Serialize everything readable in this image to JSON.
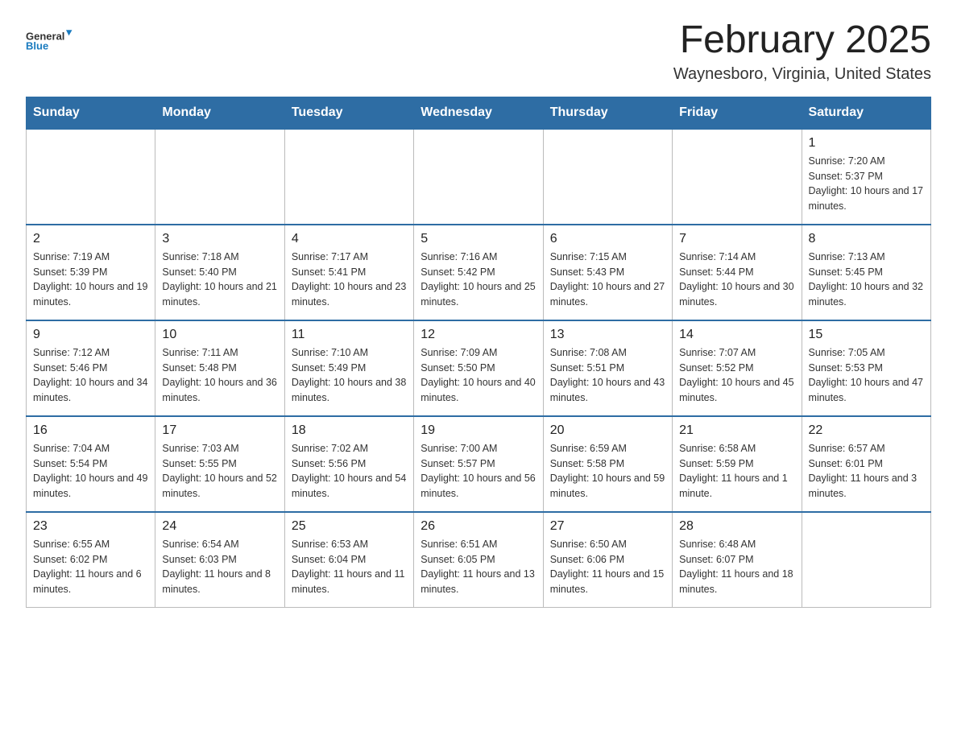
{
  "header": {
    "month_title": "February 2025",
    "location": "Waynesboro, Virginia, United States"
  },
  "days_of_week": [
    "Sunday",
    "Monday",
    "Tuesday",
    "Wednesday",
    "Thursday",
    "Friday",
    "Saturday"
  ],
  "weeks": [
    [
      {
        "day": "",
        "info": ""
      },
      {
        "day": "",
        "info": ""
      },
      {
        "day": "",
        "info": ""
      },
      {
        "day": "",
        "info": ""
      },
      {
        "day": "",
        "info": ""
      },
      {
        "day": "",
        "info": ""
      },
      {
        "day": "1",
        "info": "Sunrise: 7:20 AM\nSunset: 5:37 PM\nDaylight: 10 hours and 17 minutes."
      }
    ],
    [
      {
        "day": "2",
        "info": "Sunrise: 7:19 AM\nSunset: 5:39 PM\nDaylight: 10 hours and 19 minutes."
      },
      {
        "day": "3",
        "info": "Sunrise: 7:18 AM\nSunset: 5:40 PM\nDaylight: 10 hours and 21 minutes."
      },
      {
        "day": "4",
        "info": "Sunrise: 7:17 AM\nSunset: 5:41 PM\nDaylight: 10 hours and 23 minutes."
      },
      {
        "day": "5",
        "info": "Sunrise: 7:16 AM\nSunset: 5:42 PM\nDaylight: 10 hours and 25 minutes."
      },
      {
        "day": "6",
        "info": "Sunrise: 7:15 AM\nSunset: 5:43 PM\nDaylight: 10 hours and 27 minutes."
      },
      {
        "day": "7",
        "info": "Sunrise: 7:14 AM\nSunset: 5:44 PM\nDaylight: 10 hours and 30 minutes."
      },
      {
        "day": "8",
        "info": "Sunrise: 7:13 AM\nSunset: 5:45 PM\nDaylight: 10 hours and 32 minutes."
      }
    ],
    [
      {
        "day": "9",
        "info": "Sunrise: 7:12 AM\nSunset: 5:46 PM\nDaylight: 10 hours and 34 minutes."
      },
      {
        "day": "10",
        "info": "Sunrise: 7:11 AM\nSunset: 5:48 PM\nDaylight: 10 hours and 36 minutes."
      },
      {
        "day": "11",
        "info": "Sunrise: 7:10 AM\nSunset: 5:49 PM\nDaylight: 10 hours and 38 minutes."
      },
      {
        "day": "12",
        "info": "Sunrise: 7:09 AM\nSunset: 5:50 PM\nDaylight: 10 hours and 40 minutes."
      },
      {
        "day": "13",
        "info": "Sunrise: 7:08 AM\nSunset: 5:51 PM\nDaylight: 10 hours and 43 minutes."
      },
      {
        "day": "14",
        "info": "Sunrise: 7:07 AM\nSunset: 5:52 PM\nDaylight: 10 hours and 45 minutes."
      },
      {
        "day": "15",
        "info": "Sunrise: 7:05 AM\nSunset: 5:53 PM\nDaylight: 10 hours and 47 minutes."
      }
    ],
    [
      {
        "day": "16",
        "info": "Sunrise: 7:04 AM\nSunset: 5:54 PM\nDaylight: 10 hours and 49 minutes."
      },
      {
        "day": "17",
        "info": "Sunrise: 7:03 AM\nSunset: 5:55 PM\nDaylight: 10 hours and 52 minutes."
      },
      {
        "day": "18",
        "info": "Sunrise: 7:02 AM\nSunset: 5:56 PM\nDaylight: 10 hours and 54 minutes."
      },
      {
        "day": "19",
        "info": "Sunrise: 7:00 AM\nSunset: 5:57 PM\nDaylight: 10 hours and 56 minutes."
      },
      {
        "day": "20",
        "info": "Sunrise: 6:59 AM\nSunset: 5:58 PM\nDaylight: 10 hours and 59 minutes."
      },
      {
        "day": "21",
        "info": "Sunrise: 6:58 AM\nSunset: 5:59 PM\nDaylight: 11 hours and 1 minute."
      },
      {
        "day": "22",
        "info": "Sunrise: 6:57 AM\nSunset: 6:01 PM\nDaylight: 11 hours and 3 minutes."
      }
    ],
    [
      {
        "day": "23",
        "info": "Sunrise: 6:55 AM\nSunset: 6:02 PM\nDaylight: 11 hours and 6 minutes."
      },
      {
        "day": "24",
        "info": "Sunrise: 6:54 AM\nSunset: 6:03 PM\nDaylight: 11 hours and 8 minutes."
      },
      {
        "day": "25",
        "info": "Sunrise: 6:53 AM\nSunset: 6:04 PM\nDaylight: 11 hours and 11 minutes."
      },
      {
        "day": "26",
        "info": "Sunrise: 6:51 AM\nSunset: 6:05 PM\nDaylight: 11 hours and 13 minutes."
      },
      {
        "day": "27",
        "info": "Sunrise: 6:50 AM\nSunset: 6:06 PM\nDaylight: 11 hours and 15 minutes."
      },
      {
        "day": "28",
        "info": "Sunrise: 6:48 AM\nSunset: 6:07 PM\nDaylight: 11 hours and 18 minutes."
      },
      {
        "day": "",
        "info": ""
      }
    ]
  ]
}
